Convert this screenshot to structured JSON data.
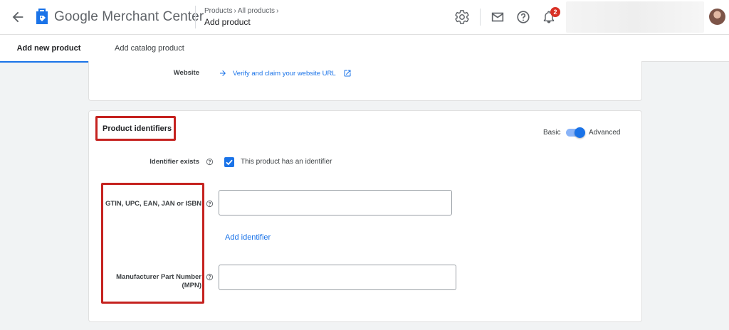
{
  "header": {
    "brand": "Google Merchant Center",
    "breadcrumbs": [
      "Products",
      "All products"
    ],
    "page_title": "Add product",
    "notification_count": "2",
    "icons": [
      "arrow-back-icon",
      "merchant-logo-icon",
      "gear-icon",
      "mail-icon",
      "help-icon",
      "bell-icon",
      "avatar"
    ]
  },
  "tabs": [
    {
      "label": "Add new product",
      "active": true
    },
    {
      "label": "Add catalog product",
      "active": false
    }
  ],
  "website_section": {
    "label": "Website",
    "link": "Verify and claim your website URL"
  },
  "identifiers_section": {
    "title": "Product identifiers",
    "mode_basic": "Basic",
    "mode_advanced": "Advanced",
    "mode": "Advanced",
    "identifier_exists_label": "Identifier exists",
    "identifier_checkbox_text": "This product has an identifier",
    "identifier_checked": true,
    "gtin_label": "GTIN, UPC, EAN, JAN or ISBN",
    "gtin_value": "",
    "add_identifier": "Add identifier",
    "mpn_label_line1": "Manufacturer Part Number",
    "mpn_label_line2": "(MPN)",
    "mpn_value": ""
  },
  "colors": {
    "accent": "#1a73e8",
    "highlight_box": "#c5221f",
    "badge": "#d93025"
  }
}
